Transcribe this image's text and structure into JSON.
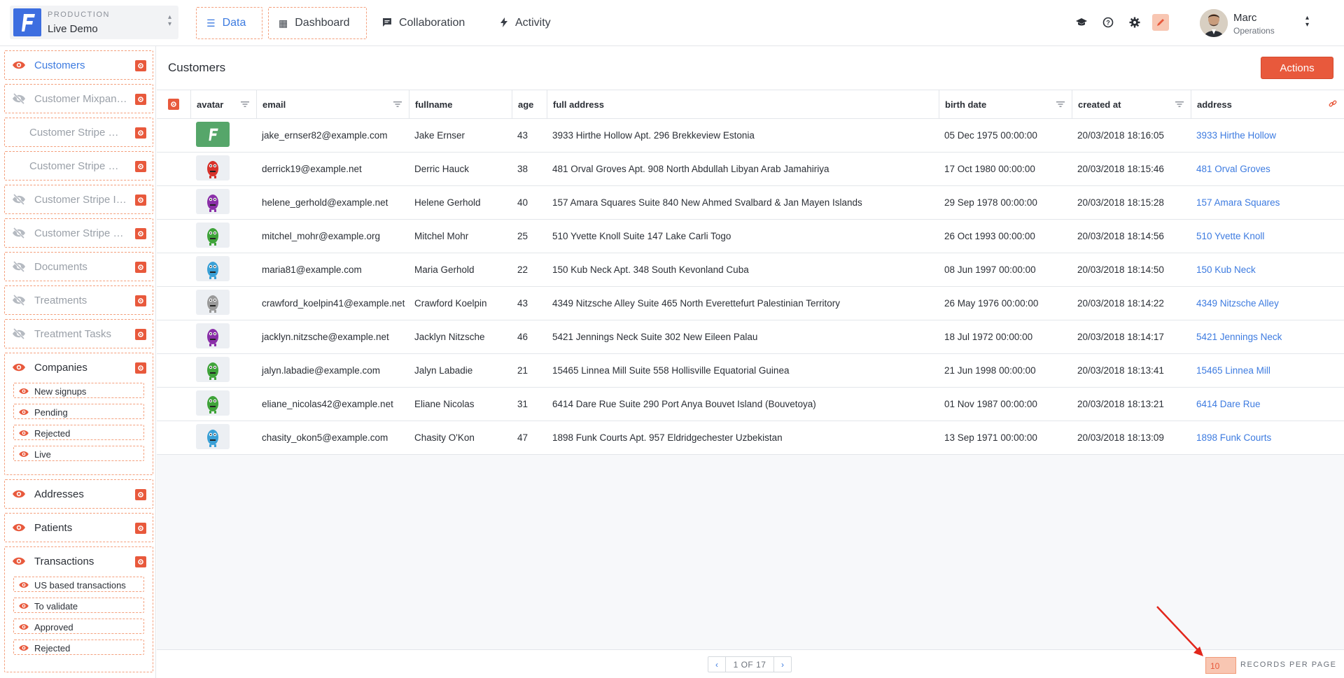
{
  "project": {
    "env": "PRODUCTION",
    "name": "Live Demo"
  },
  "nav": [
    {
      "label": "Data",
      "icon": "list-icon",
      "active": true
    },
    {
      "label": "Dashboard",
      "icon": "dashboard-icon",
      "active": false
    },
    {
      "label": "Collaboration",
      "icon": "chat-icon",
      "active": false
    },
    {
      "label": "Activity",
      "icon": "bolt-icon",
      "active": false
    }
  ],
  "toolbar_icons": [
    "graduation-cap-icon",
    "help-icon",
    "gear-icon",
    "edit-layout-icon"
  ],
  "user": {
    "name": "Marc",
    "role": "Operations"
  },
  "colors": {
    "accent": "#3d7be0",
    "brand_orange": "#e8593c",
    "edit_highlight": "#f8c6b2",
    "logo_blue": "#3d6ee0"
  },
  "sidebar": {
    "items": [
      {
        "label": "Customers",
        "state": "active"
      },
      {
        "label": "Customer Mixpanel Events",
        "state": "hidden"
      },
      {
        "label": "Customer Stripe Bank Accounts",
        "state": "hidden"
      },
      {
        "label": "Customer Stripe Cards",
        "state": "hidden"
      },
      {
        "label": "Customer Stripe Invoices",
        "state": "hidden"
      },
      {
        "label": "Customer Stripe Payments",
        "state": "hidden"
      },
      {
        "label": "Documents",
        "state": "hidden"
      },
      {
        "label": "Treatments",
        "state": "hidden"
      },
      {
        "label": "Treatment Tasks",
        "state": "hidden"
      }
    ],
    "companies": {
      "label": "Companies",
      "segments": [
        "New signups",
        "Pending",
        "Rejected",
        "Live"
      ]
    },
    "addresses": {
      "label": "Addresses"
    },
    "patients": {
      "label": "Patients"
    },
    "transactions": {
      "label": "Transactions",
      "segments": [
        "US based transactions",
        "To validate",
        "Approved",
        "Rejected"
      ]
    }
  },
  "main": {
    "title": "Customers",
    "actions_label": "Actions",
    "columns": [
      "avatar",
      "email",
      "fullname",
      "age",
      "full address",
      "birth date",
      "created at",
      "address"
    ],
    "rows": [
      {
        "email": "jake_ernser82@example.com",
        "fullname": "Jake Ernser",
        "age": "43",
        "full_address": "3933 Hirthe Hollow Apt. 296 Brekkeview Estonia",
        "birth": "05 Dec 1975 00:00:00",
        "created": "20/03/2018 18:16:05",
        "address": "3933 Hirthe Hollow",
        "avatar": "logo"
      },
      {
        "email": "derrick19@example.net",
        "fullname": "Derric Hauck",
        "age": "38",
        "full_address": "481 Orval Groves Apt. 908 North Abdullah Libyan Arab Jamahiriya",
        "birth": "17 Oct 1980 00:00:00",
        "created": "20/03/2018 18:15:46",
        "address": "481 Orval Groves",
        "avatar": "#d6322b"
      },
      {
        "email": "helene_gerhold@example.net",
        "fullname": "Helene Gerhold",
        "age": "40",
        "full_address": "157 Amara Squares Suite 840 New Ahmed Svalbard & Jan Mayen Islands",
        "birth": "29 Sep 1978 00:00:00",
        "created": "20/03/2018 18:15:28",
        "address": "157 Amara Squares",
        "avatar": "#8a2fa8"
      },
      {
        "email": "mitchel_mohr@example.org",
        "fullname": "Mitchel Mohr",
        "age": "25",
        "full_address": "510 Yvette Knoll Suite 147 Lake Carli Togo",
        "birth": "26 Oct 1993 00:00:00",
        "created": "20/03/2018 18:14:56",
        "address": "510 Yvette Knoll",
        "avatar": "#3fa33a"
      },
      {
        "email": "maria81@example.com",
        "fullname": "Maria Gerhold",
        "age": "22",
        "full_address": "150 Kub Neck Apt. 348 South Kevonland Cuba",
        "birth": "08 Jun 1997 00:00:00",
        "created": "20/03/2018 18:14:50",
        "address": "150 Kub Neck",
        "avatar": "#3aa0d6"
      },
      {
        "email": "crawford_koelpin41@example.net",
        "fullname": "Crawford Koelpin",
        "age": "43",
        "full_address": "4349 Nitzsche Alley Suite 465 North Everettefurt Palestinian Territory",
        "birth": "26 May 1976 00:00:00",
        "created": "20/03/2018 18:14:22",
        "address": "4349 Nitzsche Alley",
        "avatar": "#9a9a9a"
      },
      {
        "email": "jacklyn.nitzsche@example.net",
        "fullname": "Jacklyn Nitzsche",
        "age": "46",
        "full_address": "5421 Jennings Neck Suite 302 New Eileen Palau",
        "birth": "18 Jul 1972 00:00:00",
        "created": "20/03/2018 18:14:17",
        "address": "5421 Jennings Neck",
        "avatar": "#8a2fa8"
      },
      {
        "email": "jalyn.labadie@example.com",
        "fullname": "Jalyn Labadie",
        "age": "21",
        "full_address": "15465 Linnea Mill Suite 558 Hollisville Equatorial Guinea",
        "birth": "21 Jun 1998 00:00:00",
        "created": "20/03/2018 18:13:41",
        "address": "15465 Linnea Mill",
        "avatar": "#3fa33a"
      },
      {
        "email": "eliane_nicolas42@example.net",
        "fullname": "Eliane Nicolas",
        "age": "31",
        "full_address": "6414 Dare Rue Suite 290 Port Anya Bouvet Island (Bouvetoya)",
        "birth": "01 Nov 1987 00:00:00",
        "created": "20/03/2018 18:13:21",
        "address": "6414 Dare Rue",
        "avatar": "#3fa33a"
      },
      {
        "email": "chasity_okon5@example.com",
        "fullname": "Chasity O'Kon",
        "age": "47",
        "full_address": "1898 Funk Courts Apt. 957 Eldridgechester Uzbekistan",
        "birth": "13 Sep 1971 00:00:00",
        "created": "20/03/2018 18:13:09",
        "address": "1898 Funk Courts",
        "avatar": "#3aa0d6"
      }
    ]
  },
  "footer": {
    "page_info": "1 OF 17",
    "records_per_page": "10",
    "records_label": "RECORDS PER PAGE"
  }
}
